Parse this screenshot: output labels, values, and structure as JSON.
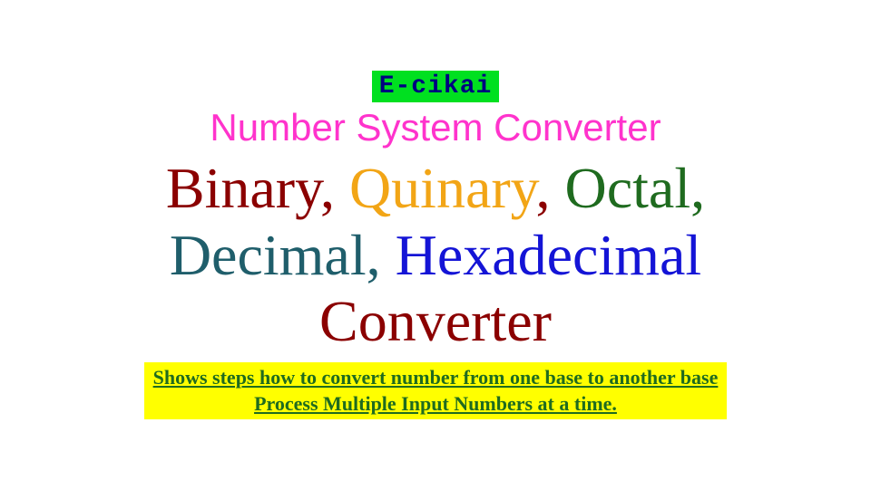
{
  "brand": "E-cikai",
  "title": "Number System Converter",
  "systems": {
    "binary": "Binary",
    "quinary": "Quinary",
    "octal": "Octal",
    "decimal": "Decimal",
    "hexadecimal": "Hexadecimal",
    "converter": "Converter"
  },
  "footer": {
    "line1": "Shows steps how to convert number from one base to another base",
    "line2": "Process Multiple Input Numbers at a time."
  }
}
